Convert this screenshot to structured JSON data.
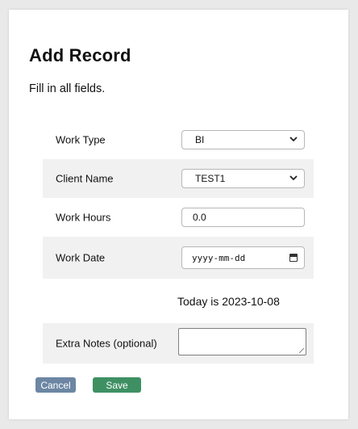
{
  "form": {
    "title": "Add Record",
    "subtitle": "Fill in all fields.",
    "fields": {
      "work_type": {
        "label": "Work Type",
        "value": "BI"
      },
      "client_name": {
        "label": "Client Name",
        "value": "TEST1"
      },
      "work_hours": {
        "label": "Work Hours",
        "value": "0.0"
      },
      "work_date": {
        "label": "Work Date",
        "placeholder": "yyyy-mm-dd"
      },
      "extra_notes": {
        "label": "Extra Notes (optional)",
        "value": ""
      }
    },
    "today_text": "Today is 2023-10-08"
  },
  "buttons": {
    "cancel_label": "Cancel",
    "save_label": "Save"
  },
  "colors": {
    "cancel_button": "#6c86a3",
    "save_button": "#3e9063",
    "row_shade": "#f1f1f1"
  },
  "icons": {
    "select_arrow": "chevron-down-icon",
    "date_picker": "calendar-icon"
  }
}
